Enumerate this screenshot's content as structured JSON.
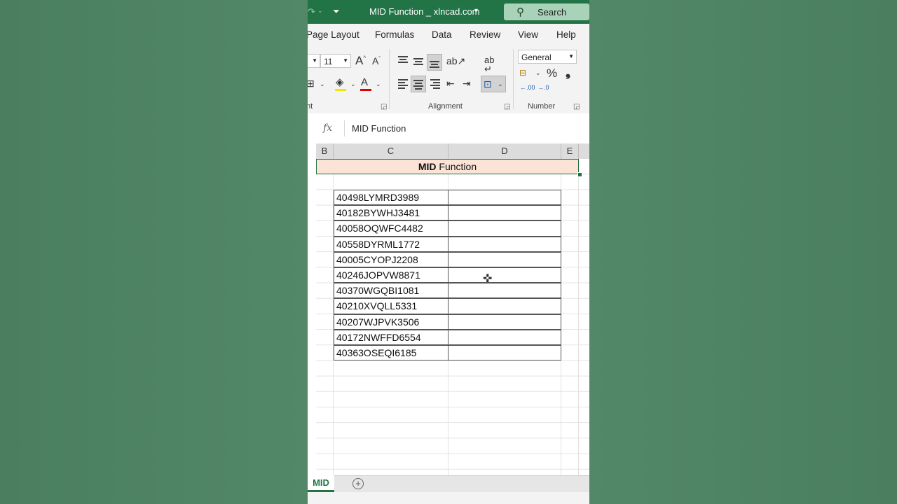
{
  "window": {
    "title": "MID Function _ xlncad.com"
  },
  "search": {
    "label": "Search"
  },
  "tabs": [
    "Page Layout",
    "Formulas",
    "Data",
    "Review",
    "View",
    "Help"
  ],
  "ribbon": {
    "font_size": "11",
    "number_format": "General",
    "group_font_partial": "nt",
    "group_alignment": "Alignment",
    "group_number": "Number",
    "increase_decimal": ".00",
    "decrease_decimal": ".0"
  },
  "formula_bar": {
    "fx": "fx",
    "value": "MID Function"
  },
  "columns": [
    "B",
    "C",
    "D",
    "E"
  ],
  "title_cell": {
    "bold": "MID",
    "rest": " Function"
  },
  "codes": [
    "40498LYMRD3989",
    "40182BYWHJ3481",
    "40058OQWFC4482",
    "40558DYRML1772",
    "40005CYOPJ2208",
    "40246JOPVW8871",
    "40370WGQBI1081",
    "40210XVQLL5331",
    "40207WJPVK3506",
    "40172NWFFD6554",
    "40363OSEQI6185"
  ],
  "sheet_tabs": [
    "MID"
  ],
  "colors": {
    "excel_green": "#217346",
    "title_fill": "#fbe4d6",
    "background": "#4e8262"
  }
}
